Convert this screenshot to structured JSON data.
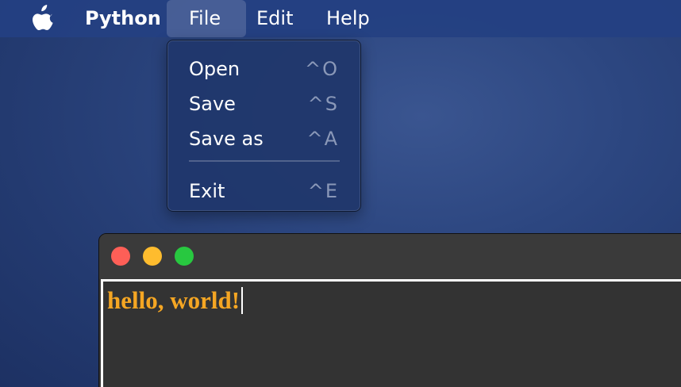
{
  "menubar": {
    "app_name": "Python",
    "menus": [
      {
        "label": "File"
      },
      {
        "label": "Edit"
      },
      {
        "label": "Help"
      }
    ],
    "active_menu": "File"
  },
  "file_menu": {
    "items": [
      {
        "label": "Open",
        "shortcut": "^O"
      },
      {
        "label": "Save",
        "shortcut": "^S"
      },
      {
        "label": "Save as",
        "shortcut": "^A"
      },
      {
        "label": "Exit",
        "shortcut": "^E"
      }
    ]
  },
  "window": {
    "traffic_lights": [
      "close",
      "minimize",
      "zoom"
    ],
    "text_content": "hello, world!",
    "text_color": "#f5a623"
  },
  "colors": {
    "desktop": "#2a437c",
    "menu_text": "#ffffff",
    "shortcut_text": "#8a98b8",
    "close": "#fe5f57",
    "minimize": "#febc2e",
    "zoom": "#28c840"
  }
}
